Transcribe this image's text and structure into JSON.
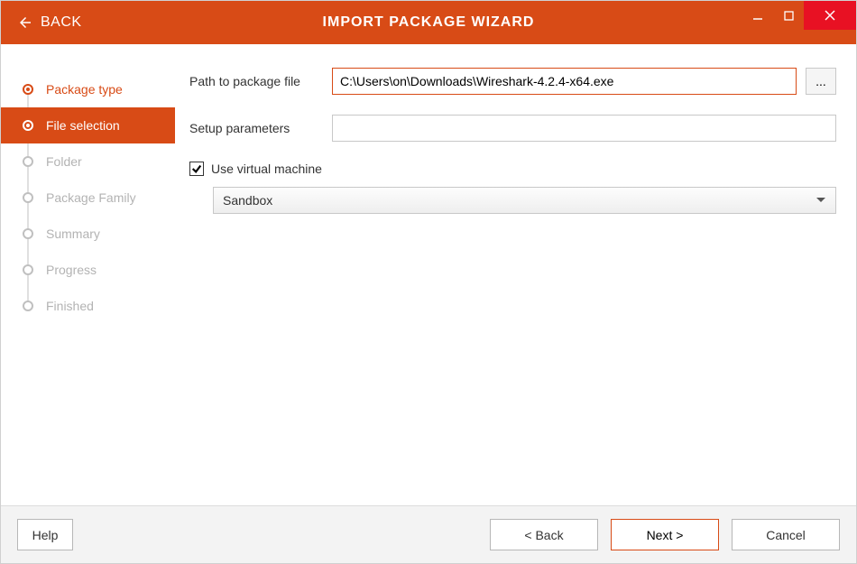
{
  "header": {
    "back_label": "BACK",
    "title": "IMPORT PACKAGE WIZARD"
  },
  "steps": [
    {
      "label": "Package type",
      "state": "done"
    },
    {
      "label": "File selection",
      "state": "active"
    },
    {
      "label": "Folder",
      "state": "pending"
    },
    {
      "label": "Package Family",
      "state": "pending"
    },
    {
      "label": "Summary",
      "state": "pending"
    },
    {
      "label": "Progress",
      "state": "pending"
    },
    {
      "label": "Finished",
      "state": "pending"
    }
  ],
  "form": {
    "path_label": "Path to package file",
    "path_value": "C:\\Users\\on\\Downloads\\Wireshark-4.2.4-x64.exe",
    "browse_label": "...",
    "setup_label": "Setup parameters",
    "setup_value": "",
    "use_vm_label": "Use virtual machine",
    "use_vm_checked": true,
    "vm_selected": "Sandbox"
  },
  "footer": {
    "help": "Help",
    "back": "< Back",
    "next": "Next >",
    "cancel": "Cancel"
  },
  "colors": {
    "accent": "#d84b16",
    "close": "#e81123"
  }
}
